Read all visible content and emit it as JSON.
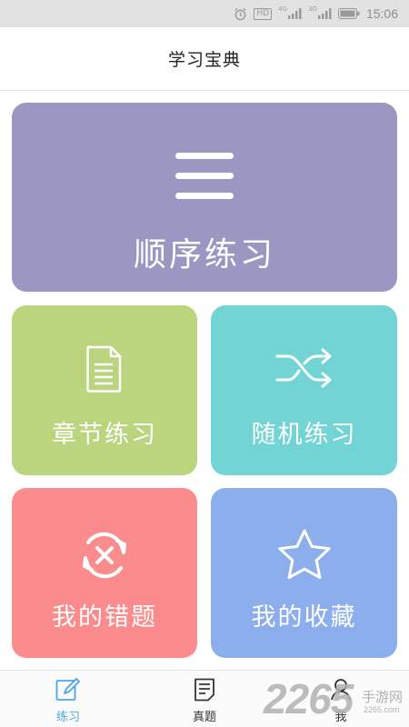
{
  "status_bar": {
    "hd_label": "HD",
    "signal_1_label": "4G",
    "signal_2_label": "3G",
    "time": "15:06"
  },
  "header": {
    "title": "学习宝典"
  },
  "cards": {
    "sequential": {
      "label": "顺序练习",
      "color": "#9b97c3",
      "icon": "menu-icon"
    },
    "chapter": {
      "label": "章节练习",
      "color": "#bad57e",
      "icon": "document-icon"
    },
    "random": {
      "label": "随机练习",
      "color": "#72d4d4",
      "icon": "shuffle-icon"
    },
    "wrong": {
      "label": "我的错题",
      "color": "#fc8b8d",
      "icon": "refresh-x-icon"
    },
    "favorites": {
      "label": "我的收藏",
      "color": "#8daeed",
      "icon": "star-icon"
    }
  },
  "bottom_nav": {
    "items": [
      {
        "label": "练习",
        "icon": "pencil-icon",
        "active": true
      },
      {
        "label": "真题",
        "icon": "notes-icon",
        "active": false
      },
      {
        "label": "我",
        "icon": "user-icon",
        "active": false
      }
    ],
    "active_color": "#4aa6e8"
  },
  "watermark": {
    "number": "2265",
    "text": "手游网",
    "url": "2265.com"
  }
}
